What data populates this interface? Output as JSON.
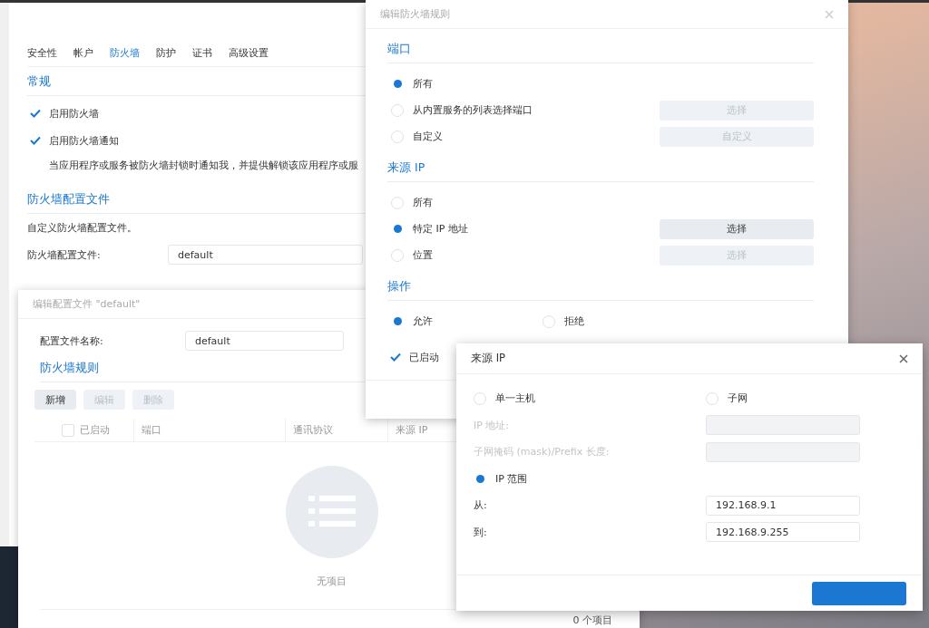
{
  "main_window": {
    "tabs": [
      {
        "label": "安全性",
        "selected": false
      },
      {
        "label": "帐户",
        "selected": false
      },
      {
        "label": "防火墙",
        "selected": true
      },
      {
        "label": "防护",
        "selected": false
      },
      {
        "label": "证书",
        "selected": false
      },
      {
        "label": "高级设置",
        "selected": false
      }
    ],
    "general": {
      "title": "常规",
      "options": [
        {
          "label": "启用防火墙",
          "checked": true
        },
        {
          "label": "启用防火墙通知",
          "checked": true
        }
      ],
      "note": "当应用程序或服务被防火墙封锁时通知我，并提供解锁该应用程序或服"
    },
    "profile": {
      "title": "防火墙配置文件",
      "description": "自定义防火墙配置文件。",
      "label": "防火墙配置文件:",
      "value": "default"
    }
  },
  "profile_dialog": {
    "title": "编辑配置文件 \"default\"",
    "name_label": "配置文件名称:",
    "name_value": "default",
    "rules_title": "防火墙规则",
    "buttons": [
      {
        "label": "新增",
        "disabled": false
      },
      {
        "label": "编辑",
        "disabled": true
      },
      {
        "label": "删除",
        "disabled": true
      }
    ],
    "select_all_checked": false,
    "columns": [
      "已启动",
      "端口",
      "通讯协议",
      "来源 IP"
    ],
    "empty_text": "无项目",
    "footer": "0 个项目"
  },
  "rule_dialog": {
    "title": "编辑防火墙规则",
    "sections": [
      {
        "title": "端口",
        "options": [
          {
            "label": "所有",
            "selected": true
          },
          {
            "label": "从内置服务的列表选择端口",
            "selected": false,
            "button": {
              "label": "选择",
              "disabled": true
            }
          },
          {
            "label": "自定义",
            "selected": false,
            "button": {
              "label": "自定义",
              "disabled": true
            }
          }
        ]
      },
      {
        "title": "来源 IP",
        "options": [
          {
            "label": "所有",
            "selected": false
          },
          {
            "label": "特定 IP 地址",
            "selected": true,
            "button": {
              "label": "选择",
              "disabled": false
            }
          },
          {
            "label": "位置",
            "selected": false,
            "button": {
              "label": "选择",
              "disabled": true
            }
          }
        ]
      }
    ],
    "action": {
      "title": "操作",
      "options": [
        {
          "label": "允许",
          "selected": true
        },
        {
          "label": "拒绝",
          "selected": false
        }
      ]
    },
    "enabled": {
      "label": "已启动",
      "checked": true
    }
  },
  "source_ip_dialog": {
    "title": "来源 IP",
    "rows": [
      {
        "kind": "radio_pair",
        "options": [
          {
            "label": "单一主机",
            "selected": false
          },
          {
            "label": "子网",
            "selected": false
          }
        ]
      },
      {
        "kind": "field",
        "label": "IP 地址:",
        "disabled": true
      },
      {
        "kind": "field",
        "label": "子网掩码 (mask)/Prefix 长度:",
        "disabled": true
      },
      {
        "kind": "radio",
        "label": "IP 范围",
        "selected": true
      },
      {
        "kind": "field",
        "label": "从:",
        "value": "192.168.9.1",
        "disabled": false
      },
      {
        "kind": "field",
        "label": "到:",
        "value": "192.168.9.255",
        "disabled": false
      }
    ]
  }
}
